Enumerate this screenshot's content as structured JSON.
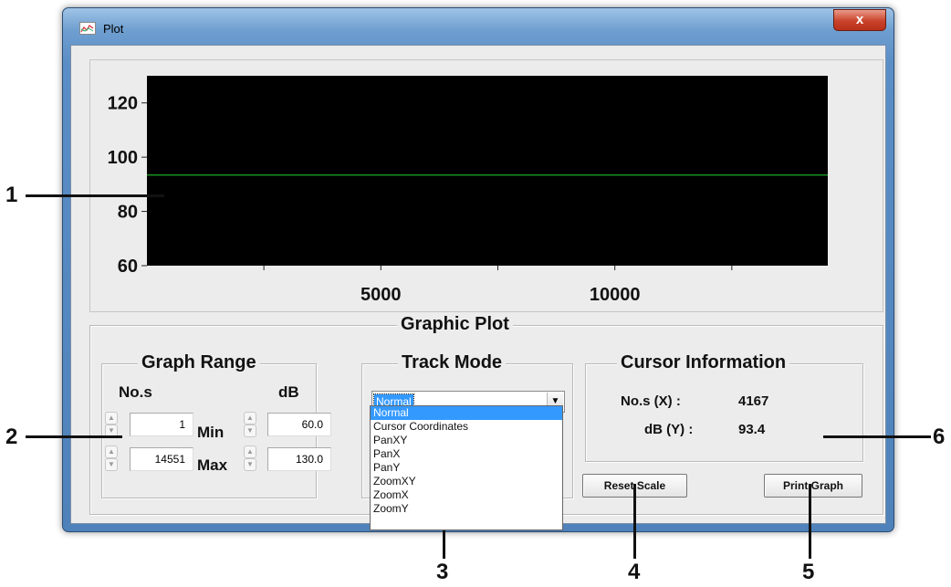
{
  "window": {
    "title": "Plot",
    "close_glyph": "x"
  },
  "chart_data": {
    "type": "line",
    "y_ticks": [
      "60",
      "80",
      "100",
      "120"
    ],
    "x_tick_labels": [
      "5000",
      "10000"
    ],
    "ylim": [
      60,
      130
    ],
    "xlim": [
      1,
      14551
    ],
    "series": [
      {
        "x": [
          1,
          14551
        ],
        "y": [
          93.4,
          93.4
        ],
        "color": "#1faa2a"
      }
    ],
    "background": "#000000",
    "grid": false
  },
  "graphic_plot": {
    "title": "Graphic Plot"
  },
  "graph_range": {
    "title": "Graph Range",
    "col_x": "No.s",
    "col_y": "dB",
    "min_label": "Min",
    "max_label": "Max",
    "x_min": "1",
    "x_max": "14551",
    "y_min": "60.0",
    "y_max": "130.0"
  },
  "track_mode": {
    "title": "Track Mode",
    "selected": "Normal",
    "options": [
      "Normal",
      "Cursor Coordinates",
      "PanXY",
      "PanX",
      "PanY",
      "ZoomXY",
      "ZoomX",
      "ZoomY"
    ]
  },
  "cursor_info": {
    "title": "Cursor Information",
    "x_label": "No.s (X) :",
    "x_value": "4167",
    "y_label": "dB (Y) :",
    "y_value": "93.4"
  },
  "buttons": {
    "reset": "Reset Scale",
    "print": "Print Graph"
  },
  "callouts": [
    "1",
    "2",
    "3",
    "4",
    "5",
    "6"
  ],
  "icons": {
    "app": "plot-app-icon",
    "close": "close-icon",
    "spin": "spin-arrows-icon",
    "dropdown": "chevron-down-icon"
  }
}
